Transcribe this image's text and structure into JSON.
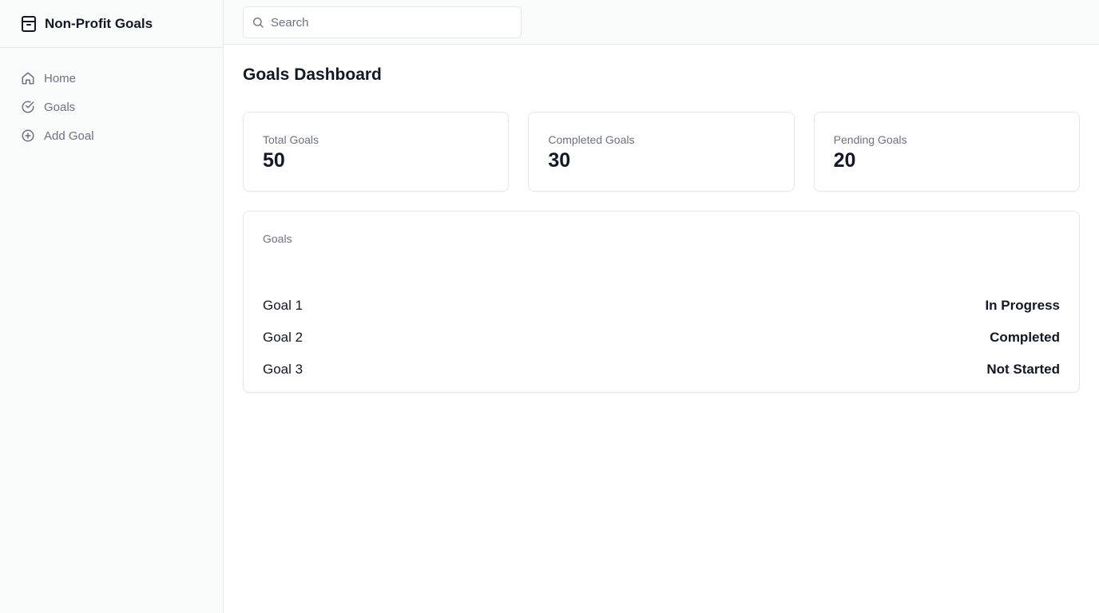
{
  "app": {
    "title": "Non-Profit Goals"
  },
  "nav": {
    "items": [
      {
        "label": "Home",
        "icon": "home-icon"
      },
      {
        "label": "Goals",
        "icon": "check-circle-icon"
      },
      {
        "label": "Add Goal",
        "icon": "plus-circle-icon"
      }
    ]
  },
  "search": {
    "placeholder": "Search",
    "value": ""
  },
  "page": {
    "title": "Goals Dashboard"
  },
  "stats": [
    {
      "label": "Total Goals",
      "value": "50"
    },
    {
      "label": "Completed Goals",
      "value": "30"
    },
    {
      "label": "Pending Goals",
      "value": "20"
    }
  ],
  "goals": {
    "heading": "Goals",
    "rows": [
      {
        "name": "Goal 1",
        "status": "In Progress"
      },
      {
        "name": "Goal 2",
        "status": "Completed"
      },
      {
        "name": "Goal 3",
        "status": "Not Started"
      }
    ]
  },
  "colors": {
    "sidebar_bg": "#f9fafa",
    "border": "#e5e7eb",
    "muted_text": "#6b7280",
    "primary_text": "#111827"
  }
}
